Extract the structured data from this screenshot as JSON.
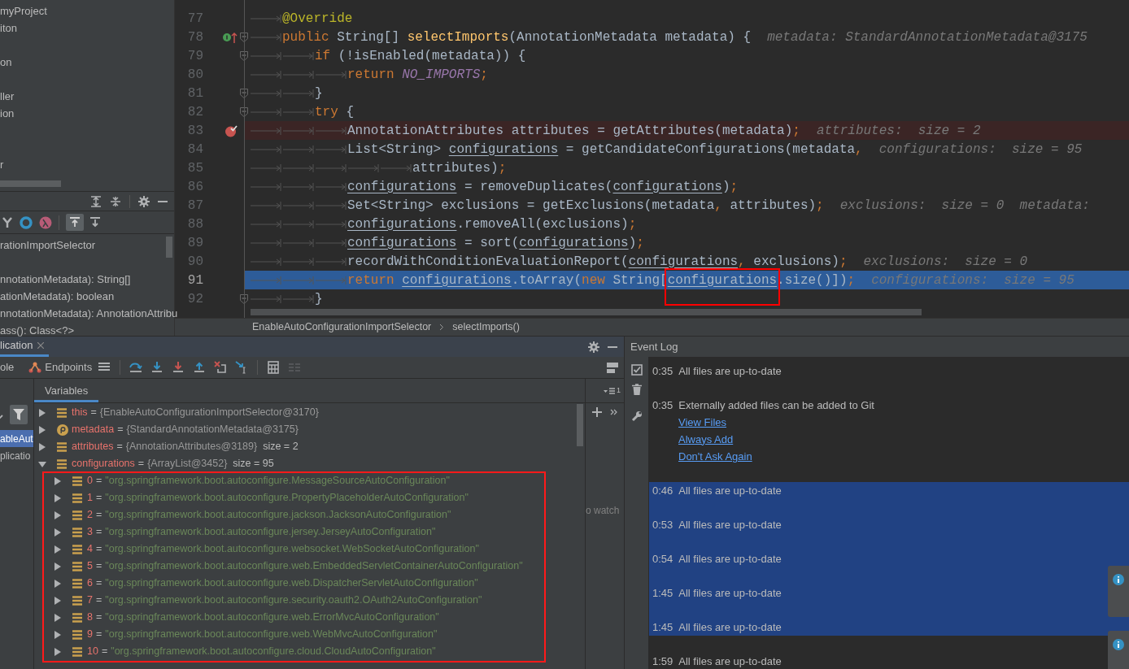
{
  "project_panel": {
    "items": [
      "myProject",
      "iton",
      "on",
      "ller",
      "ion",
      "r"
    ]
  },
  "structure_panel": {
    "items": [
      {
        "label": "rationImportSelector"
      },
      {
        "label": "nnotationMetadata): String[]"
      },
      {
        "label": "ationMetadata): boolean"
      },
      {
        "label": "nnotationMetadata): AnnotationAttribu"
      },
      {
        "label": "ass(): Class<?>"
      }
    ]
  },
  "editor": {
    "lines": [
      {
        "number": "77",
        "current": false,
        "breakpoint": false,
        "overrides": false,
        "fold": false,
        "tokens": [
          {
            "kind": "tab"
          },
          {
            "kind": "ann",
            "t": "@Override"
          }
        ]
      },
      {
        "number": "78",
        "current": false,
        "breakpoint": false,
        "overrides": true,
        "fold": true,
        "tokens": [
          {
            "kind": "tab"
          },
          {
            "kind": "kw",
            "t": "public "
          },
          {
            "kind": "plain",
            "t": "String[] "
          },
          {
            "kind": "method",
            "t": "selectImports"
          },
          {
            "kind": "plain",
            "t": "(AnnotationMetadata metadata) {"
          },
          {
            "kind": "hint",
            "t": "metadata: StandardAnnotationMetadata@3175"
          }
        ]
      },
      {
        "number": "79",
        "current": false,
        "breakpoint": false,
        "overrides": false,
        "fold": true,
        "tokens": [
          {
            "kind": "tab"
          },
          {
            "kind": "tab"
          },
          {
            "kind": "kw",
            "t": "if "
          },
          {
            "kind": "plain",
            "t": "(!isEnabled(metadata)) {"
          }
        ]
      },
      {
        "number": "80",
        "current": false,
        "breakpoint": false,
        "overrides": false,
        "fold": false,
        "tokens": [
          {
            "kind": "tab"
          },
          {
            "kind": "tab"
          },
          {
            "kind": "tab"
          },
          {
            "kind": "kw",
            "t": "return "
          },
          {
            "kind": "const",
            "t": "NO_IMPORTS"
          },
          {
            "kind": "kw",
            "t": ";"
          }
        ]
      },
      {
        "number": "81",
        "current": false,
        "breakpoint": false,
        "overrides": false,
        "fold": true,
        "tokens": [
          {
            "kind": "tab"
          },
          {
            "kind": "tab"
          },
          {
            "kind": "plain",
            "t": "}"
          }
        ]
      },
      {
        "number": "82",
        "current": false,
        "breakpoint": false,
        "overrides": false,
        "fold": true,
        "tokens": [
          {
            "kind": "tab"
          },
          {
            "kind": "tab"
          },
          {
            "kind": "kw",
            "t": "try "
          },
          {
            "kind": "plain",
            "t": "{"
          }
        ]
      },
      {
        "number": "83",
        "current": false,
        "breakpoint": true,
        "overrides": false,
        "fold": false,
        "tokens": [
          {
            "kind": "tab"
          },
          {
            "kind": "tab"
          },
          {
            "kind": "tab"
          },
          {
            "kind": "plain",
            "t": "AnnotationAttributes attributes = getAttributes(metadata)"
          },
          {
            "kind": "kw",
            "t": ";"
          },
          {
            "kind": "hint",
            "t": "attributes:  size = 2"
          }
        ]
      },
      {
        "number": "84",
        "current": false,
        "breakpoint": false,
        "overrides": false,
        "fold": false,
        "tokens": [
          {
            "kind": "tab"
          },
          {
            "kind": "tab"
          },
          {
            "kind": "tab"
          },
          {
            "kind": "plain",
            "t": "List<String> "
          },
          {
            "kind": "var",
            "t": "configurations"
          },
          {
            "kind": "plain",
            "t": " = getCandidateConfigurations(metadata"
          },
          {
            "kind": "kw",
            "t": ","
          },
          {
            "kind": "hint",
            "t": "configurations:  size = 95"
          }
        ]
      },
      {
        "number": "85",
        "current": false,
        "breakpoint": false,
        "overrides": false,
        "fold": false,
        "tokens": [
          {
            "kind": "tab"
          },
          {
            "kind": "tab"
          },
          {
            "kind": "tab"
          },
          {
            "kind": "tab"
          },
          {
            "kind": "tab"
          },
          {
            "kind": "plain",
            "t": "attributes)"
          },
          {
            "kind": "kw",
            "t": ";"
          }
        ]
      },
      {
        "number": "86",
        "current": false,
        "breakpoint": false,
        "overrides": false,
        "fold": false,
        "tokens": [
          {
            "kind": "tab"
          },
          {
            "kind": "tab"
          },
          {
            "kind": "tab"
          },
          {
            "kind": "var",
            "t": "configurations"
          },
          {
            "kind": "plain",
            "t": " = removeDuplicates("
          },
          {
            "kind": "var",
            "t": "configurations"
          },
          {
            "kind": "plain",
            "t": ")"
          },
          {
            "kind": "kw",
            "t": ";"
          }
        ]
      },
      {
        "number": "87",
        "current": false,
        "breakpoint": false,
        "overrides": false,
        "fold": false,
        "tokens": [
          {
            "kind": "tab"
          },
          {
            "kind": "tab"
          },
          {
            "kind": "tab"
          },
          {
            "kind": "plain",
            "t": "Set<String> exclusions = getExclusions(metadata"
          },
          {
            "kind": "kw",
            "t": ", "
          },
          {
            "kind": "plain",
            "t": "attributes)"
          },
          {
            "kind": "kw",
            "t": ";"
          },
          {
            "kind": "hint",
            "t": "exclusions:  size = 0  metadata:"
          }
        ]
      },
      {
        "number": "88",
        "current": false,
        "breakpoint": false,
        "overrides": false,
        "fold": false,
        "tokens": [
          {
            "kind": "tab"
          },
          {
            "kind": "tab"
          },
          {
            "kind": "tab"
          },
          {
            "kind": "var",
            "t": "configurations"
          },
          {
            "kind": "plain",
            "t": ".removeAll(exclusions)"
          },
          {
            "kind": "kw",
            "t": ";"
          }
        ]
      },
      {
        "number": "89",
        "current": false,
        "breakpoint": false,
        "overrides": false,
        "fold": false,
        "tokens": [
          {
            "kind": "tab"
          },
          {
            "kind": "tab"
          },
          {
            "kind": "tab"
          },
          {
            "kind": "var",
            "t": "configurations"
          },
          {
            "kind": "plain",
            "t": " = sort("
          },
          {
            "kind": "var",
            "t": "configurations"
          },
          {
            "kind": "plain",
            "t": ")"
          },
          {
            "kind": "kw",
            "t": ";"
          }
        ]
      },
      {
        "number": "90",
        "current": false,
        "breakpoint": false,
        "overrides": false,
        "fold": false,
        "tokens": [
          {
            "kind": "tab"
          },
          {
            "kind": "tab"
          },
          {
            "kind": "tab"
          },
          {
            "kind": "plain",
            "t": "recordWithConditionEvaluationReport("
          },
          {
            "kind": "var",
            "t": "configurations"
          },
          {
            "kind": "kw",
            "t": ", "
          },
          {
            "kind": "plain",
            "t": "exclusions)"
          },
          {
            "kind": "kw",
            "t": ";"
          },
          {
            "kind": "hint",
            "t": "exclusions:  size = 0"
          }
        ]
      },
      {
        "number": "91",
        "current": true,
        "breakpoint": false,
        "overrides": false,
        "fold": false,
        "tokens": [
          {
            "kind": "tab"
          },
          {
            "kind": "tab"
          },
          {
            "kind": "tab"
          },
          {
            "kind": "kw",
            "t": "return "
          },
          {
            "kind": "var",
            "t": "configurations"
          },
          {
            "kind": "plain",
            "t": ".toArray("
          },
          {
            "kind": "kw",
            "t": "new "
          },
          {
            "kind": "plain",
            "t": "String["
          },
          {
            "kind": "var",
            "t": "configurations",
            "highlight": true
          },
          {
            "kind": "plain",
            "t": ".size()])"
          },
          {
            "kind": "kw",
            "t": ";"
          },
          {
            "kind": "hint",
            "t": "configurations:  size = 95"
          }
        ]
      },
      {
        "number": "92",
        "current": false,
        "breakpoint": false,
        "overrides": false,
        "fold": true,
        "tokens": [
          {
            "kind": "tab"
          },
          {
            "kind": "tab"
          },
          {
            "kind": "plain",
            "t": "}"
          }
        ]
      }
    ],
    "breadcrumb": [
      "EnableAutoConfigurationImportSelector",
      "selectImports()"
    ]
  },
  "debug": {
    "tab": "lication",
    "console_label": "ole",
    "endpoints_label": "Endpoints",
    "frames": [
      {
        "label": "ableAut",
        "selected": true
      },
      {
        "label": "plicatio",
        "selected": false
      }
    ],
    "variables_tab": "Variables",
    "variables": [
      {
        "kind": "field",
        "name": "this",
        "equals": "=",
        "value": "{EnableAutoConfigurationImportSelector@3170}",
        "expanded": false
      },
      {
        "kind": "param",
        "name": "metadata",
        "equals": "=",
        "value": "{StandardAnnotationMetadata@3175}",
        "expanded": false
      },
      {
        "kind": "field",
        "name": "attributes",
        "equals": "=",
        "value": "{AnnotationAttributes@3189}",
        "extra": "size = 2",
        "expanded": false
      },
      {
        "kind": "field",
        "name": "configurations",
        "equals": "=",
        "value": "{ArrayList@3452}",
        "extra": "size = 95",
        "expanded": true,
        "highlight": true,
        "children": [
          {
            "kind": "element",
            "name": "0",
            "equals": "=",
            "value": "\"org.springframework.boot.autoconfigure.MessageSourceAutoConfiguration\"",
            "expanded": false
          },
          {
            "kind": "element",
            "name": "1",
            "equals": "=",
            "value": "\"org.springframework.boot.autoconfigure.PropertyPlaceholderAutoConfiguration\"",
            "expanded": false
          },
          {
            "kind": "element",
            "name": "2",
            "equals": "=",
            "value": "\"org.springframework.boot.autoconfigure.jackson.JacksonAutoConfiguration\"",
            "expanded": false
          },
          {
            "kind": "element",
            "name": "3",
            "equals": "=",
            "value": "\"org.springframework.boot.autoconfigure.jersey.JerseyAutoConfiguration\"",
            "expanded": false
          },
          {
            "kind": "element",
            "name": "4",
            "equals": "=",
            "value": "\"org.springframework.boot.autoconfigure.websocket.WebSocketAutoConfiguration\"",
            "expanded": false
          },
          {
            "kind": "element",
            "name": "5",
            "equals": "=",
            "value": "\"org.springframework.boot.autoconfigure.web.EmbeddedServletContainerAutoConfiguration\"",
            "expanded": false
          },
          {
            "kind": "element",
            "name": "6",
            "equals": "=",
            "value": "\"org.springframework.boot.autoconfigure.web.DispatcherServletAutoConfiguration\"",
            "expanded": false
          },
          {
            "kind": "element",
            "name": "7",
            "equals": "=",
            "value": "\"org.springframework.boot.autoconfigure.security.oauth2.OAuth2AutoConfiguration\"",
            "expanded": false
          },
          {
            "kind": "element",
            "name": "8",
            "equals": "=",
            "value": "\"org.springframework.boot.autoconfigure.web.ErrorMvcAutoConfiguration\"",
            "expanded": false
          },
          {
            "kind": "element",
            "name": "9",
            "equals": "=",
            "value": "\"org.springframework.boot.autoconfigure.web.WebMvcAutoConfiguration\"",
            "expanded": false
          },
          {
            "kind": "element",
            "name": "10",
            "equals": "=",
            "value": "\"org.springframework.boot.autoconfigure.cloud.CloudAutoConfiguration\"",
            "expanded": false
          }
        ]
      }
    ],
    "watches_badge": "1",
    "watches_text": "o watch"
  },
  "event_log": {
    "title": "Event Log",
    "entries": [
      {
        "time": "0:35",
        "message": "All files are up-to-date",
        "selected": false
      },
      {
        "time": "0:35",
        "message": "Externally added files can be added to Git",
        "links": [
          "View Files",
          "Always Add",
          "Don't Ask Again"
        ],
        "selected": false
      },
      {
        "time": "0:46",
        "message": "All files are up-to-date",
        "selected": true
      },
      {
        "time": "0:53",
        "message": "All files are up-to-date",
        "selected": true
      },
      {
        "time": "0:54",
        "message": "All files are up-to-date",
        "selected": true
      },
      {
        "time": "1:45",
        "message": "All files are up-to-date",
        "selected": true
      },
      {
        "time": "1:45",
        "message": "All files are up-to-date",
        "selected": true
      },
      {
        "time": "1:59",
        "message": "All files are up-to-date",
        "selected": false
      }
    ]
  }
}
